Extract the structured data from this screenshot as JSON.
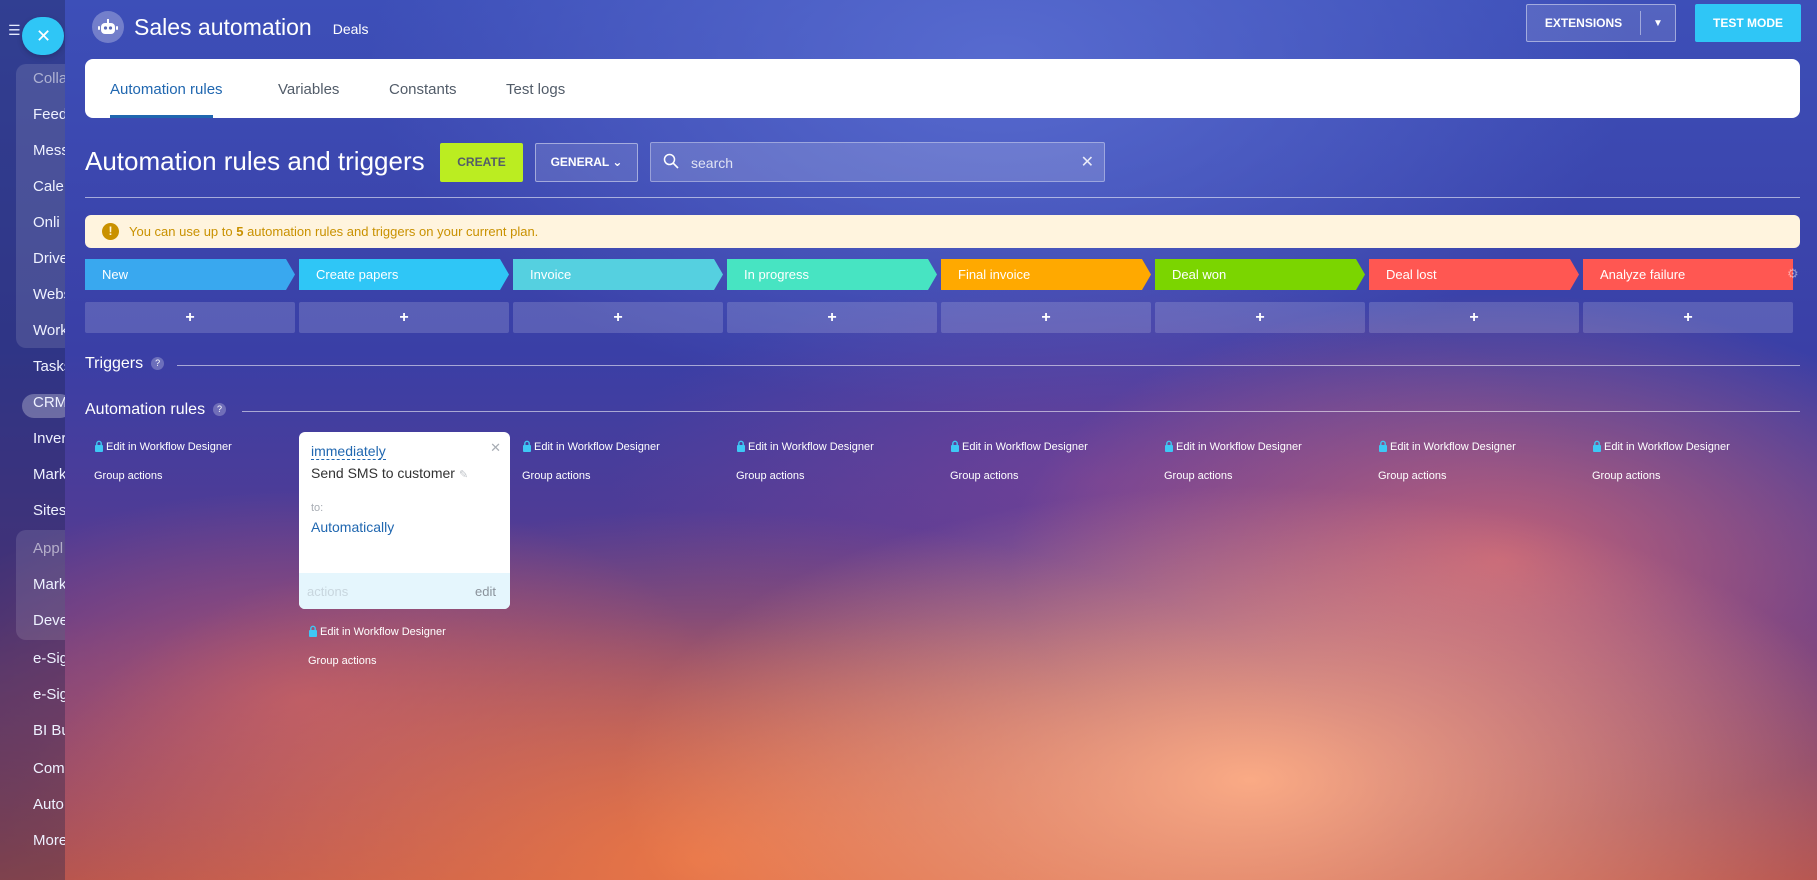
{
  "sidebar": {
    "menu_icon": "menu-icon",
    "close_icon": "close-icon",
    "items": [
      {
        "label": "Colla",
        "dim": true
      },
      {
        "label": "Feed",
        "dim": false
      },
      {
        "label": "Mess",
        "dim": false
      },
      {
        "label": "Cale",
        "dim": false
      },
      {
        "label": "Onli",
        "dim": false
      },
      {
        "label": "Drive",
        "dim": false
      },
      {
        "label": "Webs",
        "dim": false
      },
      {
        "label": "Work",
        "dim": false
      },
      {
        "label": "Tasks",
        "dim": false
      },
      {
        "label": "CRM",
        "dim": false
      },
      {
        "label": "Inver",
        "dim": false
      },
      {
        "label": "Mark",
        "dim": false
      },
      {
        "label": "Sites",
        "dim": false
      },
      {
        "label": "Appl",
        "dim": true
      },
      {
        "label": "Mark",
        "dim": false
      },
      {
        "label": "Deve",
        "dim": false
      },
      {
        "label": "e-Sig",
        "dim": false
      },
      {
        "label": "e-Sig",
        "dim": false
      },
      {
        "label": "BI Bu",
        "dim": false
      },
      {
        "label": "Com",
        "dim": false
      },
      {
        "label": "Auto",
        "dim": false
      },
      {
        "label": "More",
        "dim": false
      }
    ]
  },
  "header": {
    "title": "Sales automation",
    "subtitle": "Deals",
    "extensions_label": "EXTENSIONS",
    "test_mode_label": "TEST MODE"
  },
  "tabs": [
    {
      "label": "Automation rules",
      "active": true
    },
    {
      "label": "Variables",
      "active": false
    },
    {
      "label": "Constants",
      "active": false
    },
    {
      "label": "Test logs",
      "active": false
    }
  ],
  "toolbar": {
    "heading": "Automation rules and triggers",
    "create_label": "CREATE",
    "general_label": "GENERAL",
    "search_placeholder": "search"
  },
  "notice": {
    "text_before": "You can use up to ",
    "count": "5",
    "text_after": " automation rules and triggers on your current plan."
  },
  "stages": [
    {
      "label": "New",
      "color": "#39a8ef"
    },
    {
      "label": "Create papers",
      "color": "#2fc6f6"
    },
    {
      "label": "Invoice",
      "color": "#55d0e0"
    },
    {
      "label": "In progress",
      "color": "#47e4c2"
    },
    {
      "label": "Final invoice",
      "color": "#ffa900"
    },
    {
      "label": "Deal won",
      "color": "#7bd500"
    },
    {
      "label": "Deal lost",
      "color": "#ff5752"
    },
    {
      "label": "Analyze failure",
      "color": "#ff5752"
    }
  ],
  "add_symbol": "+",
  "sections": {
    "triggers": "Triggers",
    "automation_rules": "Automation rules",
    "help_symbol": "?"
  },
  "column_links": {
    "edit": "Edit in Workflow Designer",
    "group": "Group actions"
  },
  "robot_card": {
    "when": "immediately",
    "name": "Send SMS to customer",
    "to_label": "to:",
    "to_value": "Automatically",
    "actions_placeholder": "actions",
    "edit_label": "edit"
  }
}
